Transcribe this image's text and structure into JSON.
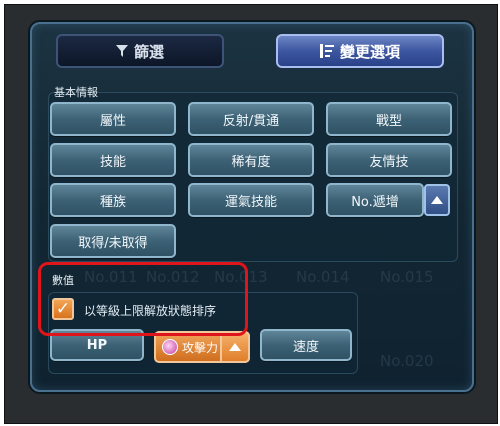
{
  "tabs": {
    "filter": {
      "icon": "filter-icon",
      "label": "篩選"
    },
    "sort": {
      "icon": "sort-icon",
      "label": "變更選項"
    }
  },
  "basic_info": {
    "label": "基本情報",
    "buttons": [
      "屬性",
      "反射/貫通",
      "戰型",
      "技能",
      "稀有度",
      "友情技",
      "種族",
      "運氣技能",
      "No.遞增",
      "取得/未取得"
    ]
  },
  "numeric": {
    "label": "數值",
    "checkbox_label": "以等級上限解放狀態排序",
    "checkbox_checked": true,
    "buttons": {
      "hp": "HP",
      "attack": "攻擊力",
      "speed": "速度"
    }
  },
  "background_text": [
    "No.011",
    "No.012",
    "No.013",
    "No.014",
    "No.015",
    "No.020"
  ],
  "colors": {
    "panel_bg": "#132733",
    "button_blue": "#3d6275",
    "active_tab": "#3c56a0",
    "selected_orange": "#d8731f",
    "highlight_red": "#e0151b"
  }
}
